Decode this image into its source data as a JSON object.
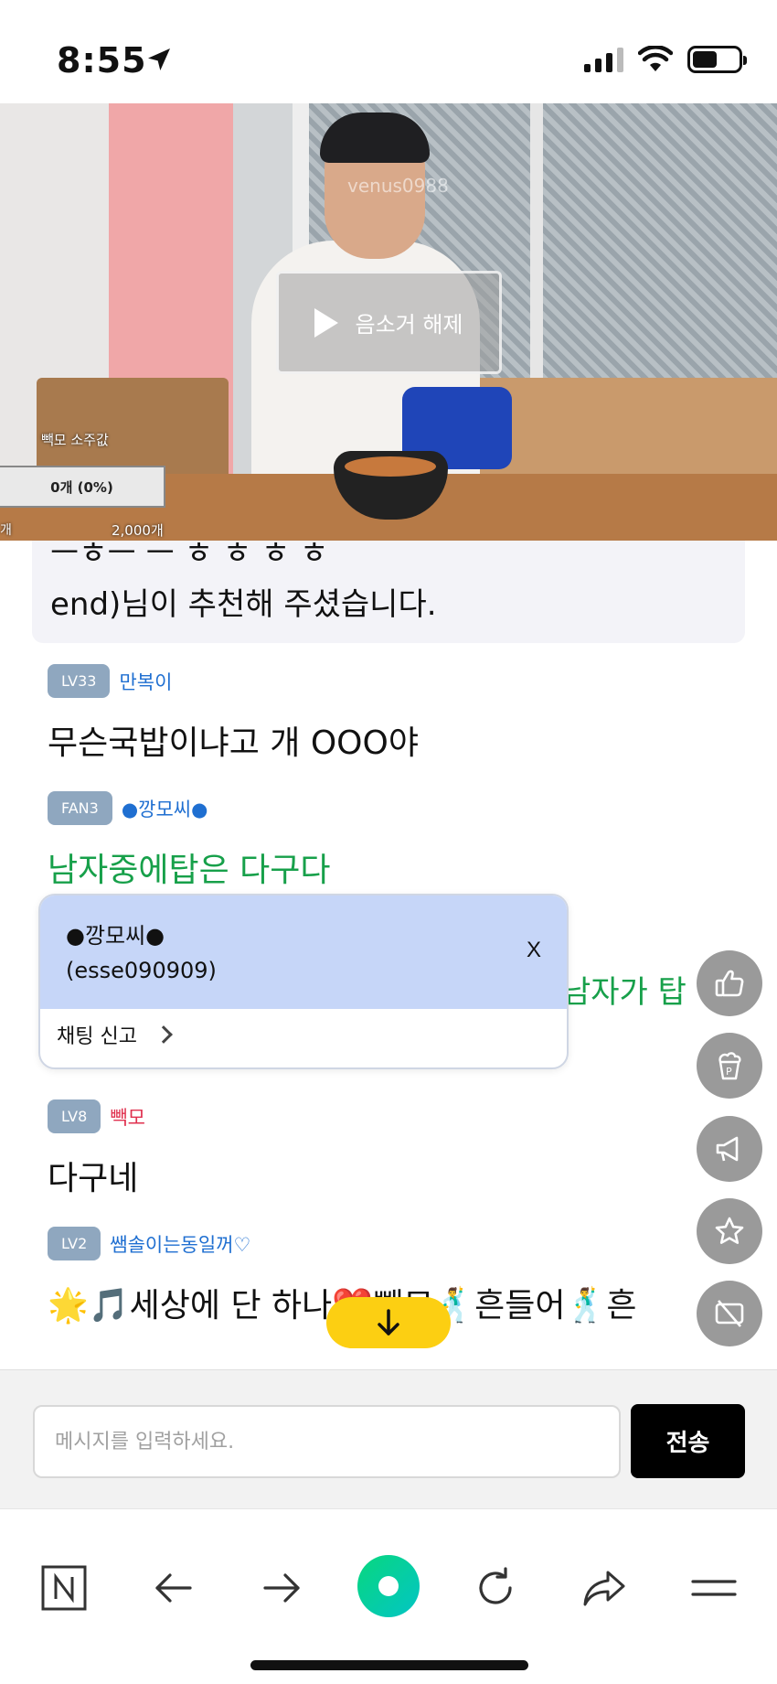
{
  "status_bar": {
    "time": "8:55"
  },
  "video": {
    "watermark": "venus0988",
    "unmute_label": "음소거 해제",
    "poll_title": "빽모 소주값",
    "poll_progress": "0개 (0%)",
    "poll_left": "개",
    "poll_amount": "2,000개"
  },
  "chat": {
    "notice_cut": "ㅡㅎㅡ ㅡ ㅎ ㅎ                                    ㅎ ㅎ",
    "notice_text": "end)님이 추천해 주셨습니다.",
    "messages": [
      {
        "badge": "LV33",
        "nick": "만복이",
        "text": "무슨국밥이냐고 개 OOO야"
      },
      {
        "badge": "FAN3",
        "nick": "●깡모씨●",
        "text": "남자중에탑은 다구다"
      },
      {
        "badge": "LV8",
        "nick": "빽모",
        "text": "다구네"
      },
      {
        "badge": "LV2",
        "nick": "쌤솔이는동일꺼♡",
        "text": "🌟🎵세상에 단 하나❤️빽모🕺흔들어🕺흔"
      }
    ],
    "hidden_tail": "남자가 탑"
  },
  "popup": {
    "nick": "●깡모씨●",
    "user_id": "(esse090909)",
    "close_label": "X",
    "report_label": "채팅 신고"
  },
  "input": {
    "placeholder": "메시지를 입력하세요.",
    "send_label": "전송"
  },
  "side_buttons": [
    "thumbs-up-icon",
    "popcorn-icon",
    "megaphone-icon",
    "star-icon",
    "hide-video-icon"
  ],
  "nav": [
    "naver-icon",
    "back-arrow-icon",
    "forward-arrow-icon",
    "green-dot-icon",
    "refresh-icon",
    "share-icon",
    "menu-icon"
  ],
  "colors": {
    "nick_blue": "#1f6fd1",
    "nick_red": "#e0314f",
    "green_text": "#17a04a",
    "popup_bg": "#c6d6f8",
    "scroll_btn": "#fccf12",
    "send_btn": "#000000"
  }
}
